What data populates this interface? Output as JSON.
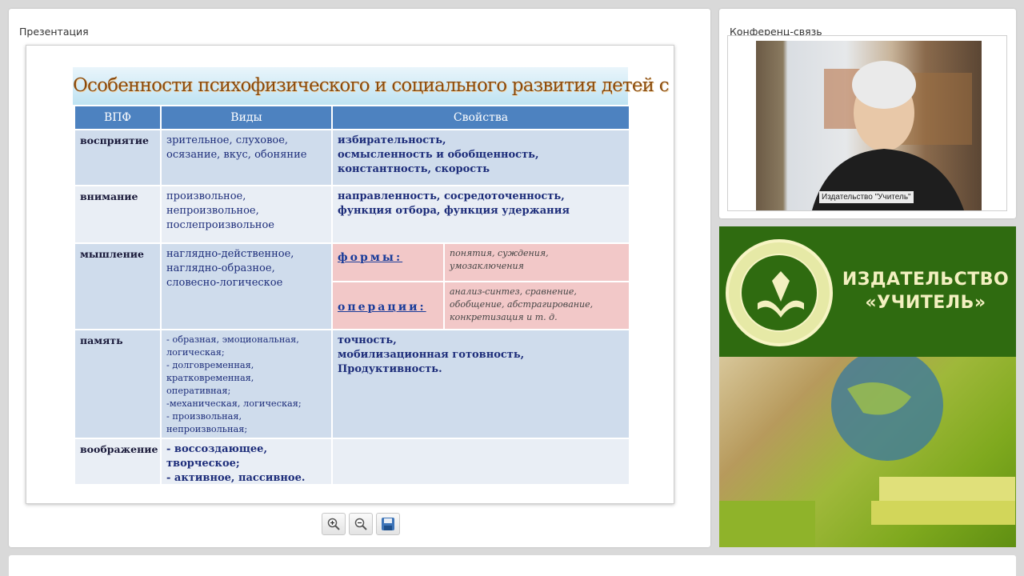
{
  "presentation_panel": {
    "title": "Презентация"
  },
  "conference_panel": {
    "title": "Конференц-связь",
    "video_caption": "Издательство \"Учитель\""
  },
  "slide": {
    "title": "Особенности психофизического и социального развития детей с ОВЗ",
    "headers": [
      "ВПФ",
      "Виды",
      "Свойства"
    ],
    "rows": {
      "perception": {
        "label": "восприятие",
        "types": [
          "зрительное, слуховое,",
          "осязание, вкус, обоняние"
        ],
        "props": [
          "избирательность,",
          "осмысленность и обобщенность,",
          "константность, скорость"
        ]
      },
      "attention": {
        "label": "внимание",
        "types": [
          "произвольное,",
          "непроизвольное,",
          "послепроизвольное"
        ],
        "props": [
          "направленность, сосредоточенность,",
          "функция отбора, функция удержания"
        ]
      },
      "thinking": {
        "label": "мышление",
        "types": [
          "наглядно-действенное,",
          "наглядно-образное,",
          "словесно-логическое"
        ],
        "forms_label": "формы:",
        "forms": [
          "понятия, суждения,",
          "умозаключения"
        ],
        "operations_label": "операции:",
        "operations": [
          "анализ-синтез, сравнение,",
          "обобщение, абстрагирование,",
          "конкретизация  и т. д."
        ]
      },
      "memory": {
        "label": "память",
        "types": [
          "- образная, эмоциональная,",
          "логическая;",
          "- долговременная,",
          "кратковременная,",
          "оперативная;",
          "-механическая, логическая;",
          "- произвольная,",
          "непроизвольная;"
        ],
        "props": [
          "точность,",
          "мобилизационная готовность,",
          "Продуктивность."
        ]
      },
      "imagination": {
        "label": "воображение",
        "types": [
          "- воссоздающее,",
          "творческое;",
          "- активное, пассивное."
        ]
      }
    }
  },
  "banner": {
    "line1": "ИЗДАТЕЛЬСТВО",
    "line2": "«УЧИТЕЛЬ»"
  },
  "toolbar": {
    "zoom_in": "zoom-in",
    "zoom_out": "zoom-out",
    "save": "save"
  },
  "colors": {
    "header_blue": "#4d82c0",
    "title_brown": "#8a4a0c",
    "banner_green": "#2f6b10"
  }
}
